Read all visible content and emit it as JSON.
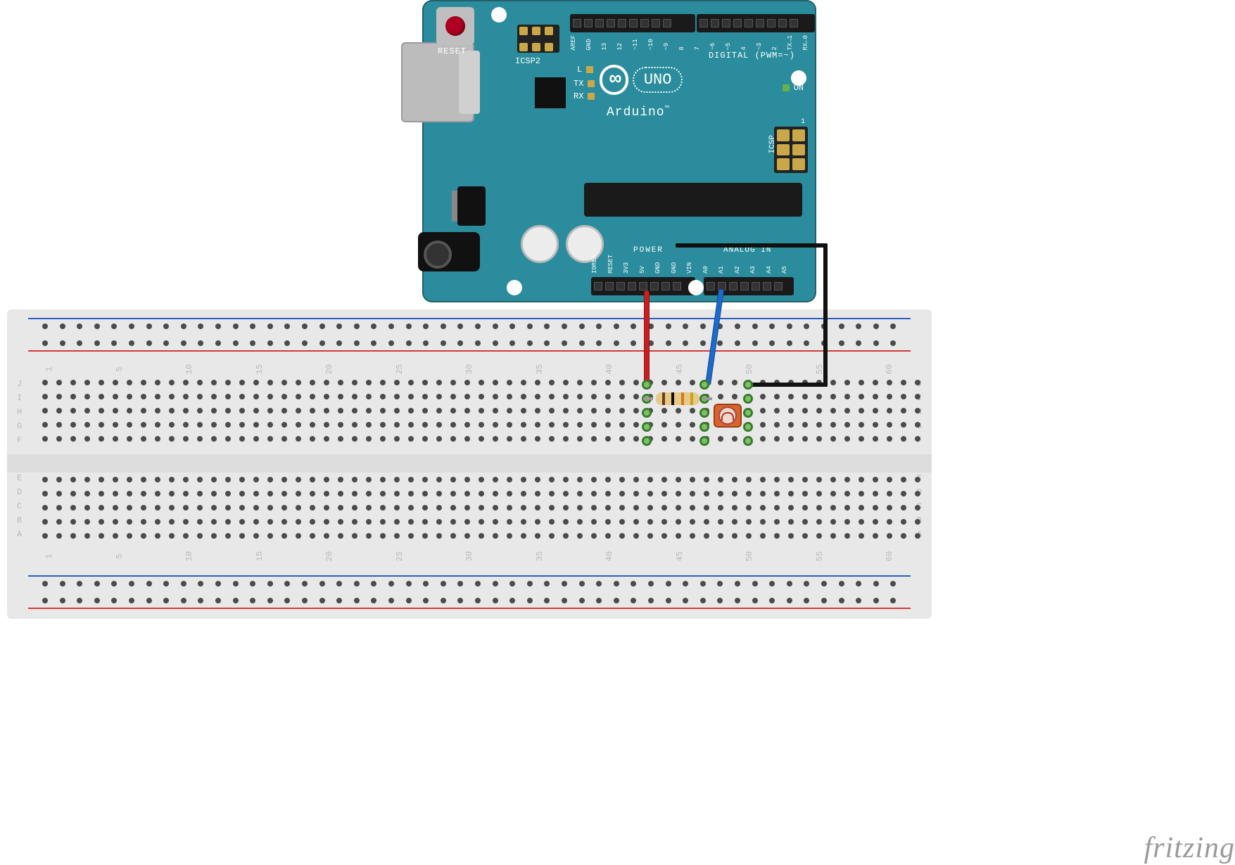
{
  "diagram": {
    "software_watermark": "fritzing",
    "description": "Arduino UNO connected to a breadboard with a photoresistor (LDR) voltage divider on analog pin A0",
    "components": [
      {
        "name": "Arduino UNO R3",
        "type": "microcontroller"
      },
      {
        "name": "Breadboard full-size",
        "type": "breadboard"
      },
      {
        "name": "Resistor",
        "type": "resistor",
        "bands": [
          "brown",
          "black",
          "orange",
          "gold"
        ],
        "value_hint": "10kΩ"
      },
      {
        "name": "Photoresistor (LDR)",
        "type": "sensor"
      }
    ],
    "wires": [
      {
        "color": "red",
        "from": "Arduino 5V",
        "to": "breadboard col 45 row J"
      },
      {
        "color": "blue",
        "from": "Arduino A0",
        "to": "breadboard col 49 row J"
      },
      {
        "color": "black",
        "from": "Arduino GND",
        "to": "breadboard col 53 row J (via routed path)"
      }
    ],
    "connections_summary": "5V → resistor → node (to A0) → LDR → GND"
  },
  "arduino": {
    "brand": "Arduino",
    "model": "UNO",
    "tm": "™",
    "reset": "RESET",
    "icsp2": "ICSP2",
    "icsp": "ICSP",
    "icsp_pin1": "1",
    "on": "ON",
    "l": "L",
    "tx": "TX",
    "rx": "RX",
    "digital": "DIGITAL (PWM=~)",
    "power": "POWER",
    "analog": "ANALOG IN",
    "pins_top": [
      "AREF",
      "GND",
      "13",
      "12",
      "~11",
      "~10",
      "~9",
      "8",
      "7",
      "~6",
      "~5",
      "4",
      "~3",
      "2",
      "TX→1",
      "RX←0"
    ],
    "pins_bottom": [
      "IOREF",
      "RESET",
      "3V3",
      "5V",
      "GND",
      "GND",
      "VIN",
      "A0",
      "A1",
      "A2",
      "A3",
      "A4",
      "A5"
    ]
  },
  "breadboard": {
    "column_numbers": [
      "1",
      "5",
      "10",
      "15",
      "20",
      "25",
      "30",
      "35",
      "40",
      "45",
      "50",
      "55",
      "60"
    ],
    "rows_top": [
      "J",
      "I",
      "H",
      "G",
      "F"
    ],
    "rows_bottom": [
      "E",
      "D",
      "C",
      "B",
      "A"
    ]
  },
  "resistor_bands": [
    {
      "color": "#6b3d1f"
    },
    {
      "color": "#111"
    },
    {
      "color": "#d87a1a"
    },
    {
      "color": "#c9a31c"
    }
  ]
}
